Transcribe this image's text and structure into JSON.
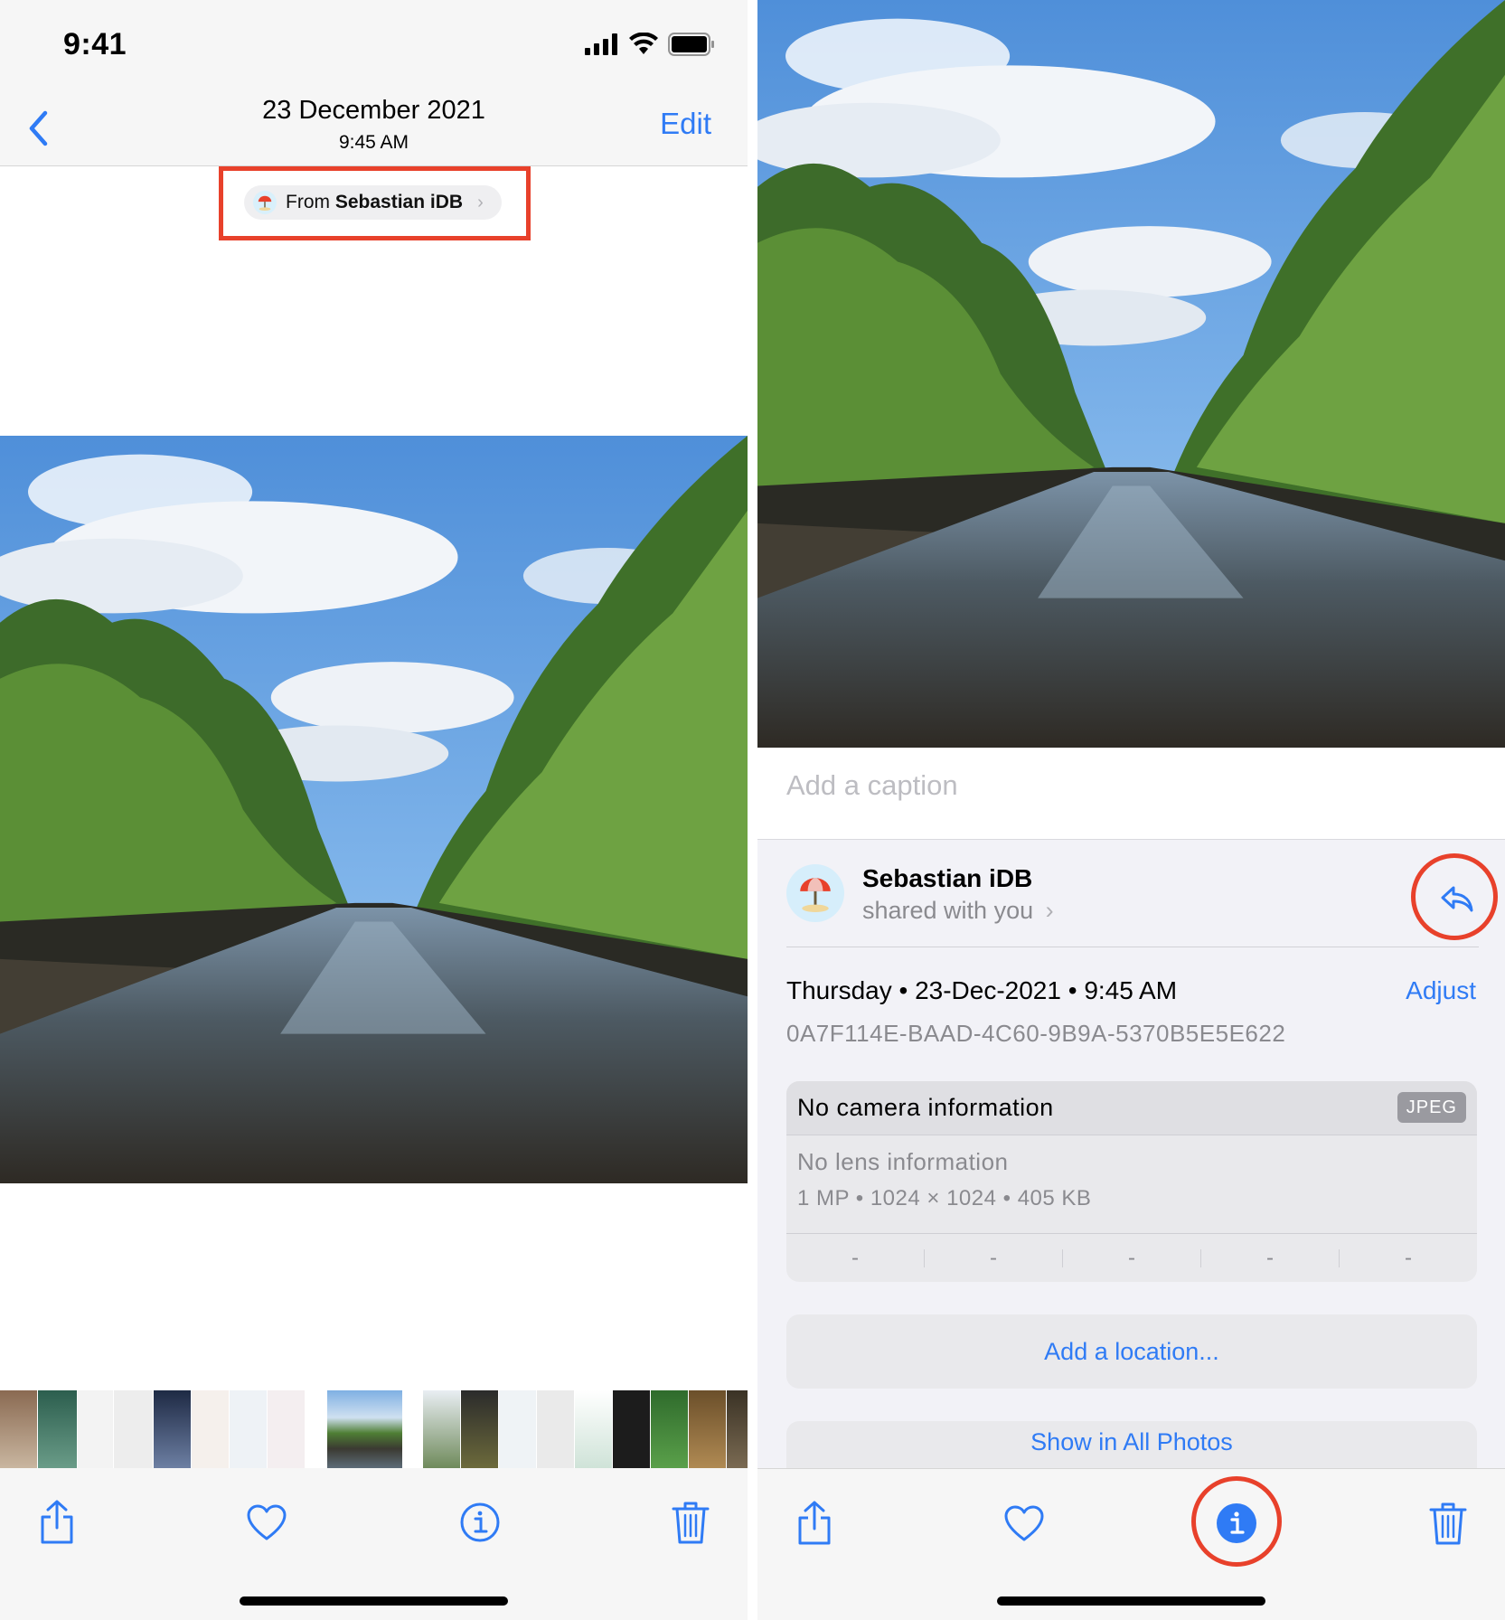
{
  "status_bar": {
    "time": "9:41"
  },
  "nav": {
    "title": "23 December 2021",
    "subtitle": "9:45 AM",
    "edit_label": "Edit"
  },
  "from_pill": {
    "prefix": "From",
    "name": "Sebastian iDB",
    "chevron": "›"
  },
  "toolbar": {
    "icons": [
      "share-icon",
      "heart-icon",
      "info-icon",
      "trash-icon"
    ]
  },
  "info": {
    "caption_placeholder": "Add a caption",
    "shared": {
      "name": "Sebastian iDB",
      "subtitle": "shared with you",
      "chevron": "›"
    },
    "date_line": "Thursday • 23-Dec-2021 • 9:45 AM",
    "adjust_label": "Adjust",
    "uuid": "0A7F114E-BAAD-4C60-9B9A-5370B5E5E622",
    "camera": {
      "title": "No camera information",
      "format": "JPEG",
      "lens": "No lens information",
      "specs": "1 MP  •  1024 × 1024  •  405 KB",
      "exif": [
        "-",
        "-",
        "-",
        "-",
        "-"
      ]
    },
    "add_location_label": "Add a location...",
    "show_all_label": "Show in All Photos"
  },
  "colors": {
    "accent": "#2f7bf5",
    "highlight": "#e8412b"
  }
}
